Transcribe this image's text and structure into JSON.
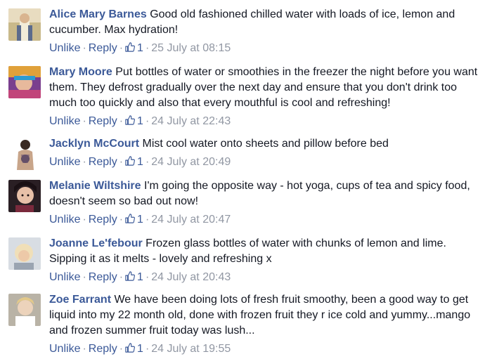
{
  "actions": {
    "unlike_label": "Unlike",
    "reply_label": "Reply",
    "separator": "·"
  },
  "icons": {
    "like": "thumbs-up-icon"
  },
  "colors": {
    "author_link": "#3b5998",
    "meta_text": "#9197a3",
    "body_text": "#141823"
  },
  "comments": [
    {
      "author": "Alice Mary Barnes",
      "text": "Good old fashioned chilled water with loads of ice, lemon and cucumber. Max hydration!",
      "likes": "1",
      "timestamp": "25 July at 08:15"
    },
    {
      "author": "Mary Moore",
      "text": "Put bottles of water or smoothies in the freezer the night before you want them. They defrost gradually over the next day and ensure that you don't drink too much too quickly and also that every mouthful is cool and refreshing!",
      "likes": "1",
      "timestamp": "24 July at 22:43"
    },
    {
      "author": "Jacklyn McCourt",
      "text": "Mist cool water onto sheets and pillow before bed",
      "likes": "1",
      "timestamp": "24 July at 20:49"
    },
    {
      "author": "Melanie Wiltshire",
      "text": "I'm going the opposite way - hot yoga, cups of tea and spicy food, doesn't seem so bad out now!",
      "likes": "1",
      "timestamp": "24 July at 20:47"
    },
    {
      "author": "Joanne Le'febour",
      "text": "Frozen glass bottles of water with chunks of lemon and lime. Sipping it as it melts - lovely and refreshing x",
      "likes": "1",
      "timestamp": "24 July at 20:43"
    },
    {
      "author": "Zoe Farrant",
      "text": "We have been doing lots of fresh fruit smoothy, been a good way to get liquid into my 22 month old, done with frozen fruit they r ice cold and yummy...mango and frozen summer fruit today was lush...",
      "likes": "1",
      "timestamp": "24 July at 19:55"
    }
  ]
}
